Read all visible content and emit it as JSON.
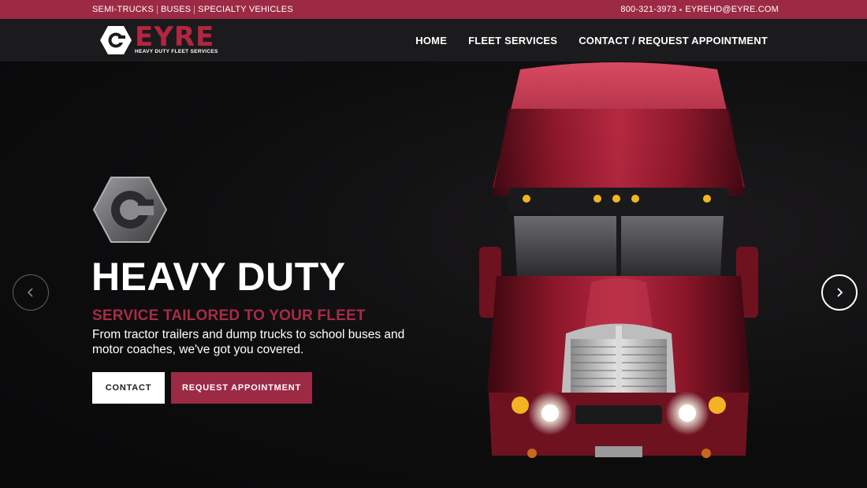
{
  "topbar": {
    "links": [
      "SEMI-TRUCKS",
      "BUSES",
      "SPECIALTY VEHICLES"
    ],
    "phone": "800-321-3973",
    "email": "EYREHD@EYRE.COM"
  },
  "header": {
    "logo": {
      "word": "EYRE",
      "tagline": "HEAVY DUTY FLEET SERVICES"
    },
    "nav": [
      "HOME",
      "FLEET SERVICES",
      "CONTACT / REQUEST APPOINTMENT"
    ]
  },
  "hero": {
    "title": "HEAVY DUTY",
    "subtitle": "SERVICE TAILORED TO YOUR FLEET",
    "description": "From tractor trailers and dump trucks to school buses and motor coaches, we've got you covered.",
    "buttons": {
      "contact": "CONTACT",
      "appointment": "REQUEST APPOINTMENT"
    },
    "arrows": {
      "prev": "chevron-left-icon",
      "next": "chevron-right-icon"
    }
  },
  "colors": {
    "accent": "#9c2a45",
    "accent_bright": "#b3263f",
    "nav_bg": "#1b1b1d",
    "hero_bg": "#0c0c0d"
  }
}
